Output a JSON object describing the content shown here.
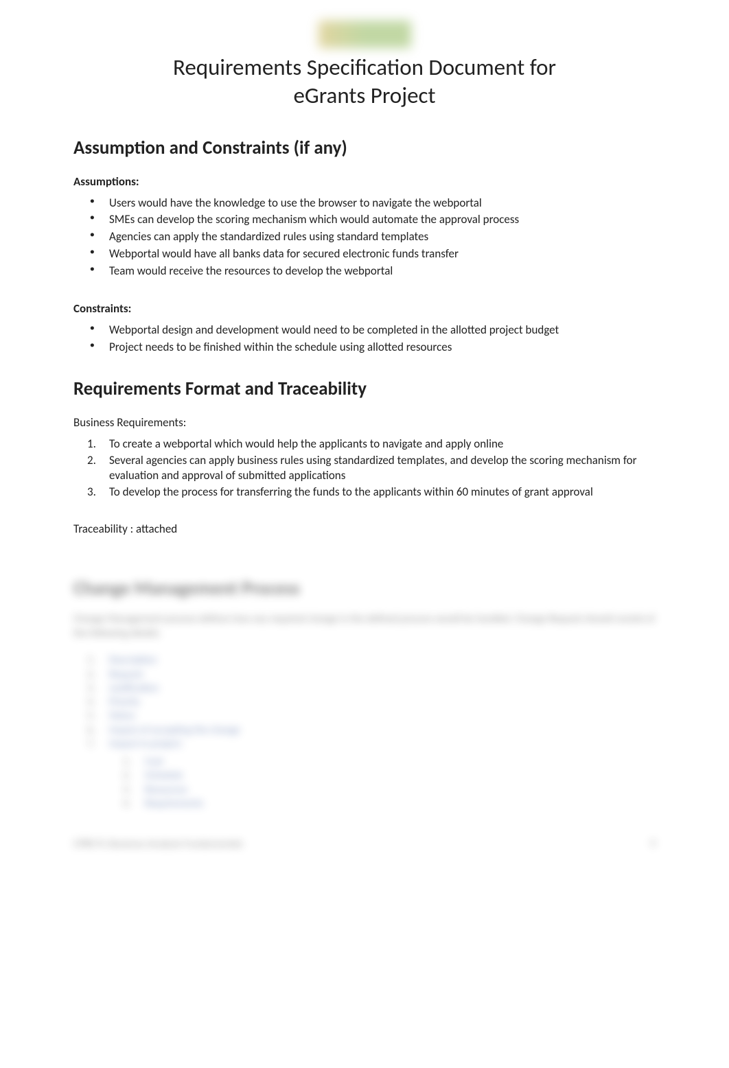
{
  "header": {
    "title_line1": "Requirements Specification Document for",
    "title_line2": "eGrants Project"
  },
  "section_assumptions": {
    "heading": "Assumption and Constraints (if any)",
    "assumptions_label": "Assumptions:",
    "assumptions": [
      "Users would have the knowledge to use the browser to navigate the webportal",
      "SMEs can develop the scoring mechanism which would automate the approval process",
      "Agencies can apply the standardized rules using standard templates",
      "Webportal would have all banks data for secured electronic funds transfer",
      "Team would receive the resources to develop the webportal"
    ],
    "constraints_label": "Constraints:",
    "constraints": [
      "Webportal design and development would need to be completed in the allotted project budget",
      "Project needs to be finished within the schedule using allotted resources"
    ]
  },
  "section_requirements": {
    "heading": "Requirements Format and Traceability",
    "br_label": "Business Requirements:",
    "business_requirements": [
      "To create a webportal which would help the applicants to navigate and apply online",
      "Several agencies can apply business rules  using standardized templates, and develop the scoring mechanism for evaluation and approval of submitted applications",
      "To develop the process for transferring the funds to the applicants within 60 minutes of grant approval"
    ],
    "traceability": "Traceability : attached"
  },
  "section_change": {
    "heading": "Change Management Process",
    "para": "Change Management process defines how any required change in the defined process would be handled. Change Request should consist of the following details:",
    "items": [
      "Description",
      "Request",
      "Justification",
      "Priority",
      "Status",
      "Impact of accepting the change",
      "Impact in project:"
    ],
    "subitems": [
      "Cost",
      "Schedule",
      "Resources",
      "Requirements"
    ]
  },
  "footer": {
    "left": "CPRE-FL Business Analysis Fundamentals",
    "right": "9"
  }
}
